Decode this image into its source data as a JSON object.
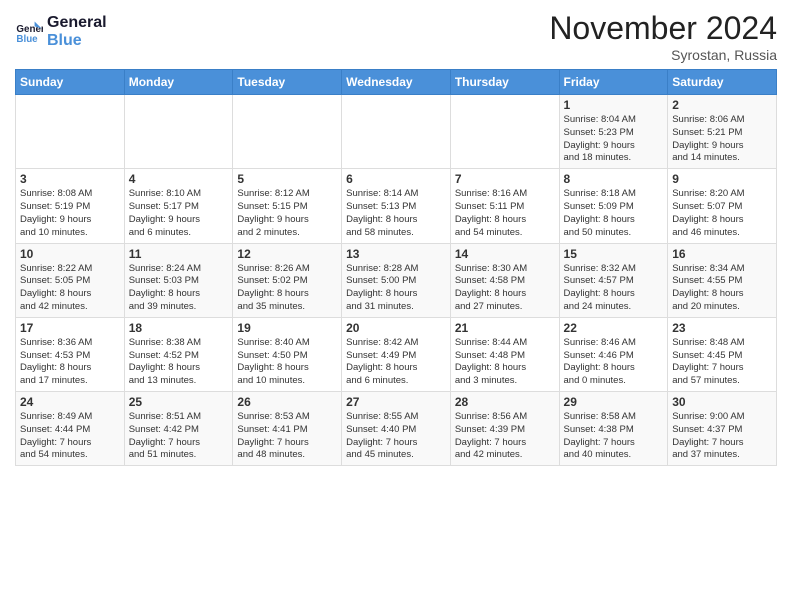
{
  "header": {
    "logo_line1": "General",
    "logo_line2": "Blue",
    "month": "November 2024",
    "location": "Syrostan, Russia"
  },
  "days_of_week": [
    "Sunday",
    "Monday",
    "Tuesday",
    "Wednesday",
    "Thursday",
    "Friday",
    "Saturday"
  ],
  "weeks": [
    [
      {
        "num": "",
        "info": ""
      },
      {
        "num": "",
        "info": ""
      },
      {
        "num": "",
        "info": ""
      },
      {
        "num": "",
        "info": ""
      },
      {
        "num": "",
        "info": ""
      },
      {
        "num": "1",
        "info": "Sunrise: 8:04 AM\nSunset: 5:23 PM\nDaylight: 9 hours\nand 18 minutes."
      },
      {
        "num": "2",
        "info": "Sunrise: 8:06 AM\nSunset: 5:21 PM\nDaylight: 9 hours\nand 14 minutes."
      }
    ],
    [
      {
        "num": "3",
        "info": "Sunrise: 8:08 AM\nSunset: 5:19 PM\nDaylight: 9 hours\nand 10 minutes."
      },
      {
        "num": "4",
        "info": "Sunrise: 8:10 AM\nSunset: 5:17 PM\nDaylight: 9 hours\nand 6 minutes."
      },
      {
        "num": "5",
        "info": "Sunrise: 8:12 AM\nSunset: 5:15 PM\nDaylight: 9 hours\nand 2 minutes."
      },
      {
        "num": "6",
        "info": "Sunrise: 8:14 AM\nSunset: 5:13 PM\nDaylight: 8 hours\nand 58 minutes."
      },
      {
        "num": "7",
        "info": "Sunrise: 8:16 AM\nSunset: 5:11 PM\nDaylight: 8 hours\nand 54 minutes."
      },
      {
        "num": "8",
        "info": "Sunrise: 8:18 AM\nSunset: 5:09 PM\nDaylight: 8 hours\nand 50 minutes."
      },
      {
        "num": "9",
        "info": "Sunrise: 8:20 AM\nSunset: 5:07 PM\nDaylight: 8 hours\nand 46 minutes."
      }
    ],
    [
      {
        "num": "10",
        "info": "Sunrise: 8:22 AM\nSunset: 5:05 PM\nDaylight: 8 hours\nand 42 minutes."
      },
      {
        "num": "11",
        "info": "Sunrise: 8:24 AM\nSunset: 5:03 PM\nDaylight: 8 hours\nand 39 minutes."
      },
      {
        "num": "12",
        "info": "Sunrise: 8:26 AM\nSunset: 5:02 PM\nDaylight: 8 hours\nand 35 minutes."
      },
      {
        "num": "13",
        "info": "Sunrise: 8:28 AM\nSunset: 5:00 PM\nDaylight: 8 hours\nand 31 minutes."
      },
      {
        "num": "14",
        "info": "Sunrise: 8:30 AM\nSunset: 4:58 PM\nDaylight: 8 hours\nand 27 minutes."
      },
      {
        "num": "15",
        "info": "Sunrise: 8:32 AM\nSunset: 4:57 PM\nDaylight: 8 hours\nand 24 minutes."
      },
      {
        "num": "16",
        "info": "Sunrise: 8:34 AM\nSunset: 4:55 PM\nDaylight: 8 hours\nand 20 minutes."
      }
    ],
    [
      {
        "num": "17",
        "info": "Sunrise: 8:36 AM\nSunset: 4:53 PM\nDaylight: 8 hours\nand 17 minutes."
      },
      {
        "num": "18",
        "info": "Sunrise: 8:38 AM\nSunset: 4:52 PM\nDaylight: 8 hours\nand 13 minutes."
      },
      {
        "num": "19",
        "info": "Sunrise: 8:40 AM\nSunset: 4:50 PM\nDaylight: 8 hours\nand 10 minutes."
      },
      {
        "num": "20",
        "info": "Sunrise: 8:42 AM\nSunset: 4:49 PM\nDaylight: 8 hours\nand 6 minutes."
      },
      {
        "num": "21",
        "info": "Sunrise: 8:44 AM\nSunset: 4:48 PM\nDaylight: 8 hours\nand 3 minutes."
      },
      {
        "num": "22",
        "info": "Sunrise: 8:46 AM\nSunset: 4:46 PM\nDaylight: 8 hours\nand 0 minutes."
      },
      {
        "num": "23",
        "info": "Sunrise: 8:48 AM\nSunset: 4:45 PM\nDaylight: 7 hours\nand 57 minutes."
      }
    ],
    [
      {
        "num": "24",
        "info": "Sunrise: 8:49 AM\nSunset: 4:44 PM\nDaylight: 7 hours\nand 54 minutes."
      },
      {
        "num": "25",
        "info": "Sunrise: 8:51 AM\nSunset: 4:42 PM\nDaylight: 7 hours\nand 51 minutes."
      },
      {
        "num": "26",
        "info": "Sunrise: 8:53 AM\nSunset: 4:41 PM\nDaylight: 7 hours\nand 48 minutes."
      },
      {
        "num": "27",
        "info": "Sunrise: 8:55 AM\nSunset: 4:40 PM\nDaylight: 7 hours\nand 45 minutes."
      },
      {
        "num": "28",
        "info": "Sunrise: 8:56 AM\nSunset: 4:39 PM\nDaylight: 7 hours\nand 42 minutes."
      },
      {
        "num": "29",
        "info": "Sunrise: 8:58 AM\nSunset: 4:38 PM\nDaylight: 7 hours\nand 40 minutes."
      },
      {
        "num": "30",
        "info": "Sunrise: 9:00 AM\nSunset: 4:37 PM\nDaylight: 7 hours\nand 37 minutes."
      }
    ]
  ]
}
